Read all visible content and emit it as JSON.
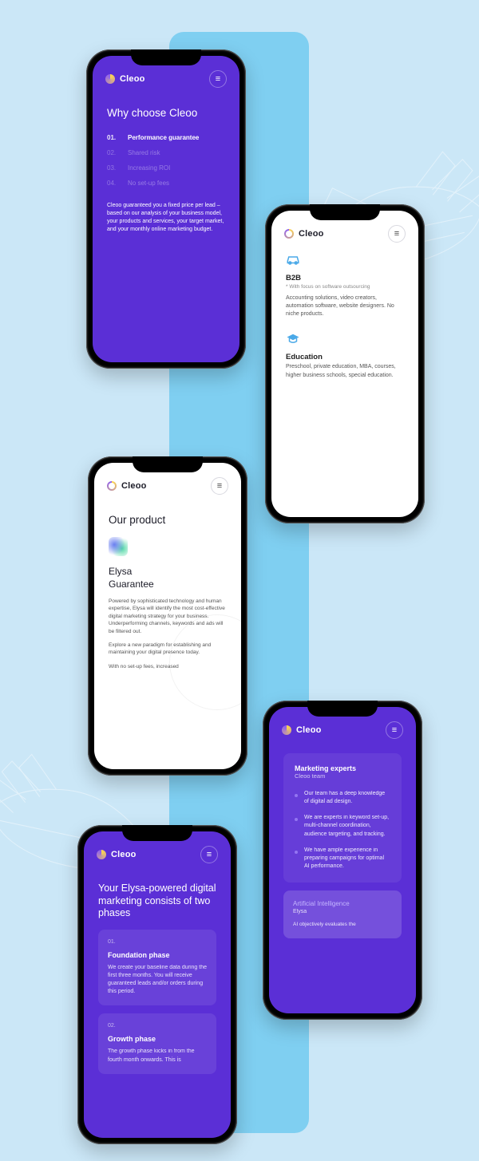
{
  "brand": "Cleoo",
  "menu_glyph": "≡",
  "screen1": {
    "title": "Why choose Cleoo",
    "items": [
      {
        "num": "01.",
        "label": "Performance guarantee",
        "active": true
      },
      {
        "num": "02.",
        "label": "Shared risk",
        "active": false
      },
      {
        "num": "03.",
        "label": "Increasing ROI",
        "active": false
      },
      {
        "num": "04.",
        "label": "No set-up fees",
        "active": false
      }
    ],
    "body": "Cleoo guaranteed you a fixed price per lead – based on our analysis of your business model, your products and services, your target market, and your monthly online marketing budget."
  },
  "screen2": {
    "cards": [
      {
        "icon": "car-icon",
        "title": "B2B",
        "note": "* With focus on software outsourcing",
        "body": "Accounting solutions, video creators, automation software, website designers. No niche products."
      },
      {
        "icon": "graduation-icon",
        "title": "Education",
        "note": "",
        "body": "Preschool, private education, MBA, courses, higher business schools, special education."
      }
    ]
  },
  "screen3": {
    "heading": "Our product",
    "name": "Elysa",
    "subtitle": "Guarantee",
    "p1": "Powered by sophisticated technology and human expertise, Elysa will identify the most cost-effective digital marketing strategy for your business. Underperforming channels, keywords and ads will be filtered out.",
    "p2": "Explore a new paradigm for establishing and maintaining your digital presence today.",
    "p3": "With no set-up fees, increased"
  },
  "screen4": {
    "title": "Your Elysa-powered digital marketing consists of two phases",
    "phases": [
      {
        "num": "01.",
        "title": "Foundation phase",
        "body": "We create your baseline data during the first three months. You will receive guaranteed leads and/or orders during this period."
      },
      {
        "num": "02.",
        "title": "Growth phase",
        "body": "The growth phase kicks in from the fourth month onwards. This is"
      }
    ]
  },
  "screen5": {
    "card_title": "Marketing experts",
    "card_sub": "Cleoo team",
    "bullets": [
      "Our team has a deep knowledge of digital ad design.",
      "We are experts in keyword set-up, multi-channel coordination, audience targeting, and tracking.",
      "We have ample experience in preparing campaigns for optimal AI performance."
    ],
    "ai_title": "Artificial Intelligence",
    "ai_sub": "Elysa",
    "ai_body": "AI objectively evaluates the"
  }
}
